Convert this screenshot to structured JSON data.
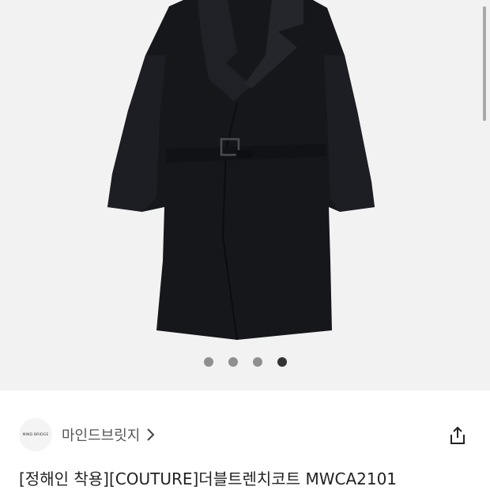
{
  "gallery": {
    "image_alt": "black double trench coat",
    "dot_count": 4,
    "active_index": 3
  },
  "brand": {
    "logo_text": "MIND BRIDGE",
    "name": "마인드브릿지",
    "chevron_icon": "chevron-right-icon"
  },
  "share_icon": "share-icon",
  "product": {
    "title": "[정해인 착용][COUTURE]더블트렌치코트 MWCA2101"
  }
}
